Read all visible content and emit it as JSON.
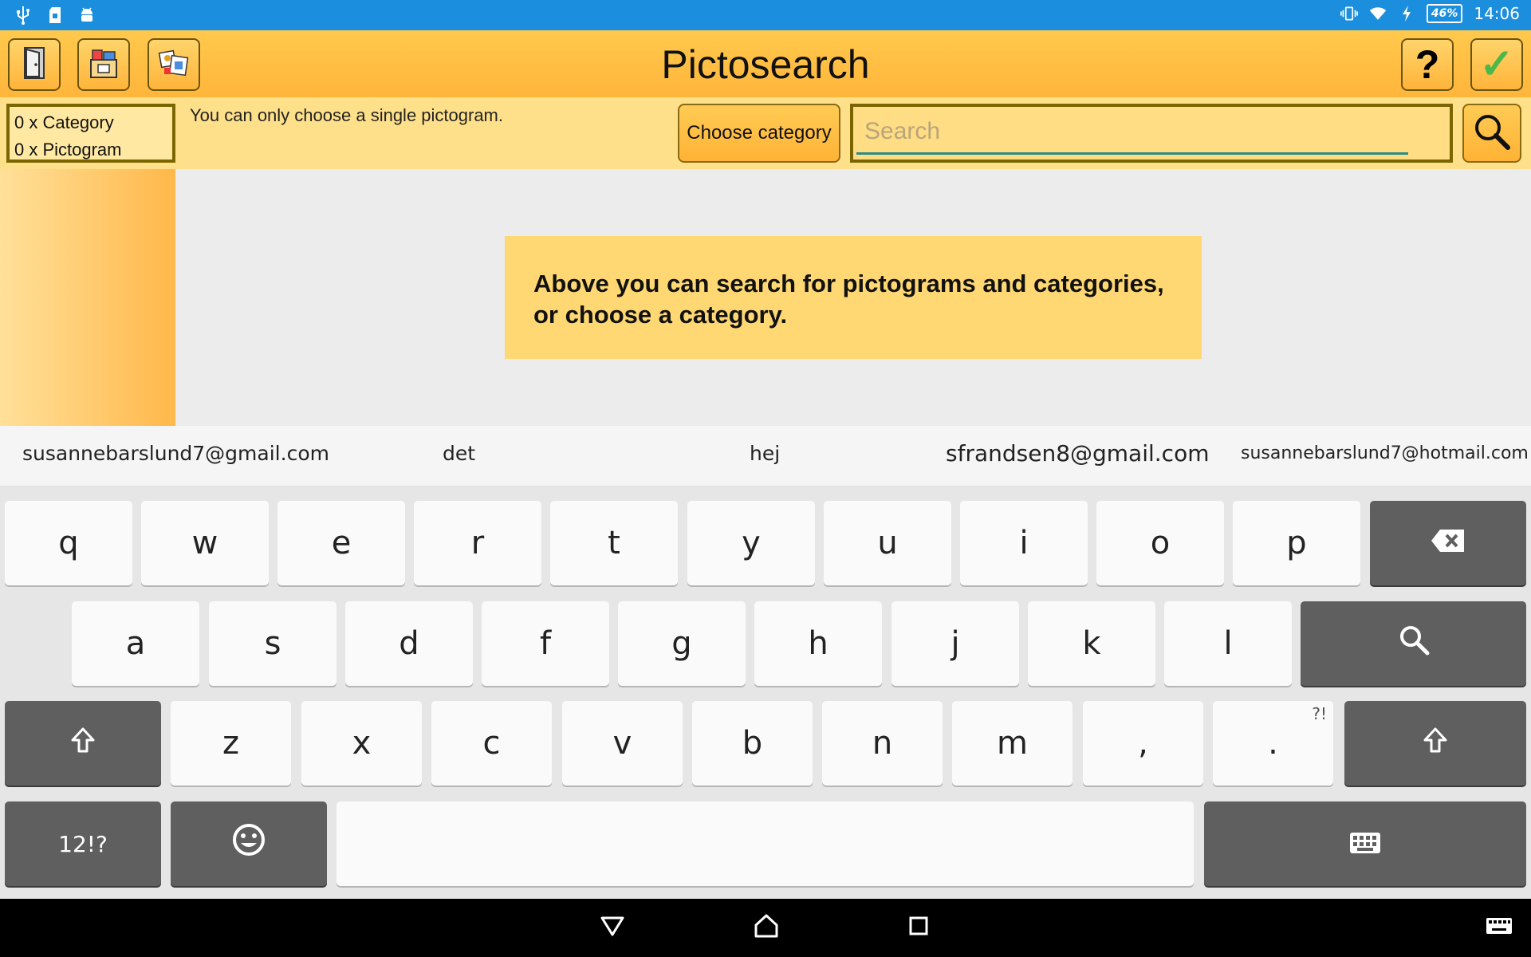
{
  "status_bar": {
    "battery": "46%",
    "time": "14:06"
  },
  "app_bar": {
    "title": "Pictosearch",
    "help_label": "?",
    "confirm_label": "✓"
  },
  "filter_bar": {
    "category_count": "0 x Category",
    "pictogram_count": "0 x Pictogram",
    "hint": "You can only choose a single pictogram.",
    "choose_category_label": "Choose category",
    "search_placeholder": "Search",
    "search_value": ""
  },
  "content": {
    "info_line1": "Above you can search for pictograms and categories,",
    "info_line2": "or choose a category."
  },
  "suggestions": [
    "susannebarslund7@gmail.com",
    "det",
    "hej",
    "sfrandsen8@gmail.com",
    "susannebarslund7@hotmail.com"
  ],
  "keyboard": {
    "row1": [
      "q",
      "w",
      "e",
      "r",
      "t",
      "y",
      "u",
      "i",
      "o",
      "p"
    ],
    "row2": [
      "a",
      "s",
      "d",
      "f",
      "g",
      "h",
      "j",
      "k",
      "l"
    ],
    "row3": [
      "z",
      "x",
      "c",
      "v",
      "b",
      "n",
      "m",
      ",",
      "."
    ],
    "period_alt": "?!",
    "symbols_label": "12!?"
  },
  "colors": {
    "status_bar": "#1b8fdd",
    "accent": "#ffb53a",
    "panel": "#ffe08a",
    "info_box": "#ffd873"
  },
  "icons": {
    "app_bar": [
      "exit-door-icon",
      "category-box-icon",
      "pictogram-gallery-icon",
      "help-icon",
      "confirm-check-icon"
    ],
    "status": [
      "usb-icon",
      "sd-card-icon",
      "android-icon",
      "vibrate-icon",
      "wifi-icon",
      "charging-icon"
    ]
  }
}
